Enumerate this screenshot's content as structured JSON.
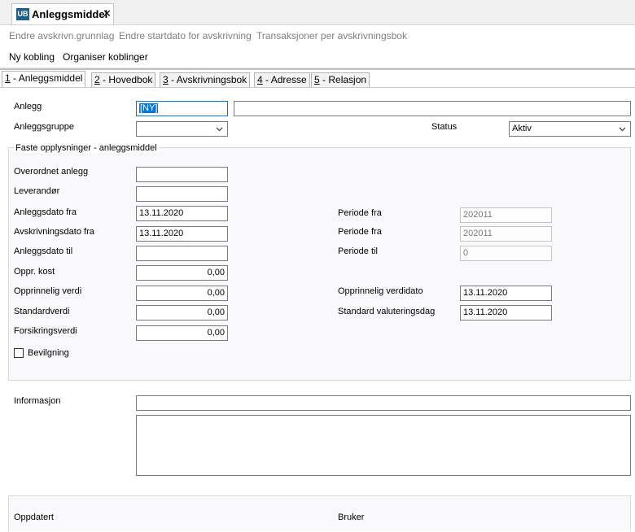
{
  "window": {
    "app_badge": "UB",
    "title": "Anleggsmiddel",
    "close_glyph": "✕"
  },
  "toolbar1": {
    "items": [
      "Endre avskrivn.grunnlag",
      "Endre startdato for avskrivning",
      "Transaksjoner per avskrivningsbok"
    ]
  },
  "toolbar2": {
    "items": [
      "Ny kobling",
      "Organiser koblinger"
    ]
  },
  "tabs": [
    {
      "key": "1",
      "label": " - Anleggsmiddel"
    },
    {
      "key": "2",
      "label": " - Hovedbok"
    },
    {
      "key": "3",
      "label": " - Avskrivningsbok"
    },
    {
      "key": "4",
      "label": " - Adresse"
    },
    {
      "key": "5",
      "label": " - Relasjon"
    }
  ],
  "form": {
    "anlegg_label": "Anlegg",
    "anlegg_value": "[NY]",
    "anlegg_desc": "",
    "gruppe_label": "Anleggsgruppe",
    "gruppe_value": "",
    "status_label": "Status",
    "status_value": "Aktiv"
  },
  "fixed": {
    "title": "Faste opplysninger - anleggsmiddel",
    "overordnet_label": "Overordnet anlegg",
    "overordnet_value": "",
    "leverandor_label": "Leverandør",
    "leverandor_value": "",
    "anleggsdato_fra_label": "Anleggsdato fra",
    "anleggsdato_fra_value": "13.11.2020",
    "avskr_fra_label": "Avskrivningsdato fra",
    "avskr_fra_value": "13.11.2020",
    "anleggsdato_til_label": "Anleggsdato til",
    "anleggsdato_til_value": "",
    "oppr_kost_label": "Oppr. kost",
    "oppr_kost_value": "0,00",
    "oppr_verdi_label": "Opprinnelig verdi",
    "oppr_verdi_value": "0,00",
    "standardverdi_label": "Standardverdi",
    "standardverdi_value": "0,00",
    "forsikring_label": "Forsikringsverdi",
    "forsikring_value": "0,00",
    "bevilgning_label": "Bevilgning",
    "periode_fra1_label": "Periode fra",
    "periode_fra1_value": "202011",
    "periode_fra2_label": "Periode fra",
    "periode_fra2_value": "202011",
    "periode_til_label": "Periode til",
    "periode_til_value": "0",
    "oppr_verdidato_label": "Opprinnelig verdidato",
    "oppr_verdidato_value": "13.11.2020",
    "std_valdag_label": "Standard valuteringsdag",
    "std_valdag_value": "13.11.2020"
  },
  "info": {
    "label": "Informasjon",
    "line_value": "",
    "text_value": ""
  },
  "footer": {
    "oppdatert_label": "Oppdatert",
    "bruker_label": "Bruker"
  },
  "colors": {
    "accent": "#0078d7",
    "badge": "#1f5f8b"
  }
}
